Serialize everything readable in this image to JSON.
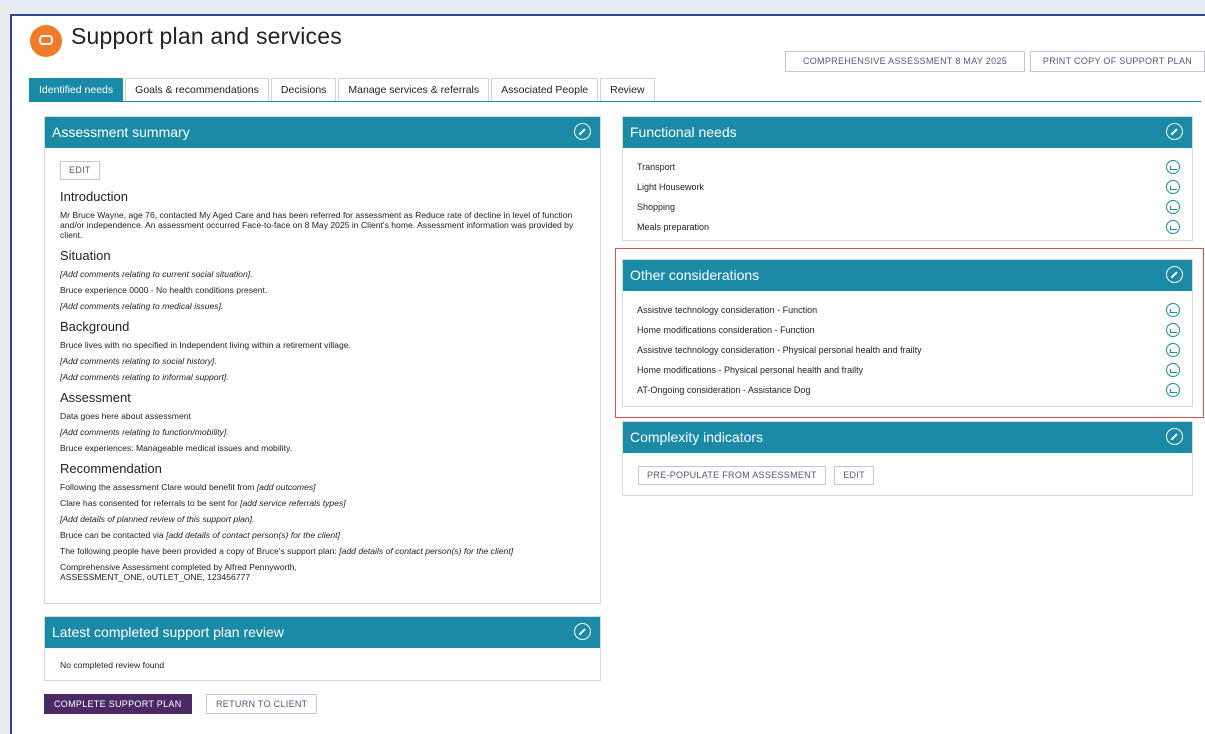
{
  "page": {
    "title": "Support plan and services"
  },
  "top_buttons": {
    "assessment": "COMPREHENSIVE ASSESSMENT 8 MAY 2025",
    "print": "PRINT COPY OF SUPPORT PLAN"
  },
  "tabs": [
    {
      "label": "Identified needs"
    },
    {
      "label": "Goals & recommendations"
    },
    {
      "label": "Decisions"
    },
    {
      "label": "Manage services & referrals"
    },
    {
      "label": "Associated People"
    },
    {
      "label": "Review"
    }
  ],
  "assessment_summary": {
    "title": "Assessment summary",
    "edit_label": "EDIT",
    "introduction_heading": "Introduction",
    "introduction_text": "Mr Bruce Wayne, age 76, contacted My Aged Care and has been referred for assessment as Reduce rate of decline in level of function and/or independence. An assessment occurred Face-to-face on 8 May 2025 in Client's home. Assessment information was provided by client.",
    "situation_heading": "Situation",
    "situation_1": "[Add comments relating to current social situation].",
    "situation_2": "Bruce experience 0000 - No health conditions present.",
    "situation_3": "[Add comments relating to medical issues].",
    "background_heading": "Background",
    "background_1": "Bruce lives with no specified in Independent living within a retirement village.",
    "background_2": "[Add comments relating to social history].",
    "background_3": "[Add comments relating to informal support].",
    "assessment_heading": "Assessment",
    "assessment_1": "Data goes here about assessment",
    "assessment_2": "[Add comments relating to function/mobility].",
    "assessment_3": "Bruce experiences: Manageable medical issues and mobility.",
    "recommendation_heading": "Recommendation",
    "rec_1_a": "Following the assessment Clare would benefit from ",
    "rec_1_b": "[add outcomes]",
    "rec_2_a": "Clare has consented for referrals to be sent for ",
    "rec_2_b": "[add service referrals types]",
    "rec_3": "[Add details of planned review of this support plan].",
    "rec_4_a": "Bruce can be contacted via ",
    "rec_4_b": "[add details of contact person(s) for the client]",
    "rec_5_a": "The following people have been provided a copy of Bruce's support plan: ",
    "rec_5_b": "[add details of contact person(s) for the client]",
    "rec_6_line1": "Comprehensive Assessment completed by Alfred Pennyworth,",
    "rec_6_line2": "ASSESSMENT_ONE, oUTLET_ONE, 123456777"
  },
  "latest_review": {
    "title": "Latest completed support plan review",
    "text": "No completed review found"
  },
  "functional_needs": {
    "title": "Functional needs",
    "items": [
      {
        "label": "Transport"
      },
      {
        "label": "Light Housework"
      },
      {
        "label": "Shopping"
      },
      {
        "label": "Meals preparation"
      }
    ]
  },
  "other_considerations": {
    "title": "Other considerations",
    "items": [
      {
        "label": "Assistive technology consideration - Function"
      },
      {
        "label": "Home modifications consideration - Function"
      },
      {
        "label": "Assistive technology consideration - Physical personal health and frailty"
      },
      {
        "label": "Home modifications - Physical personal health and frailty"
      },
      {
        "label": "AT-Ongoing consideration - Assistance Dog"
      }
    ]
  },
  "complexity_indicators": {
    "title": "Complexity indicators",
    "prepopulate_label": "PRE-POPULATE FROM ASSESSMENT",
    "edit_label": "EDIT"
  },
  "footer": {
    "complete_label": "COMPLETE SUPPORT PLAN",
    "return_label": "RETURN TO CLIENT"
  },
  "colors": {
    "teal": "#1a8aa6",
    "purple": "#4a2a66",
    "highlight": "#d9534f",
    "logo": "#f07c2a"
  }
}
